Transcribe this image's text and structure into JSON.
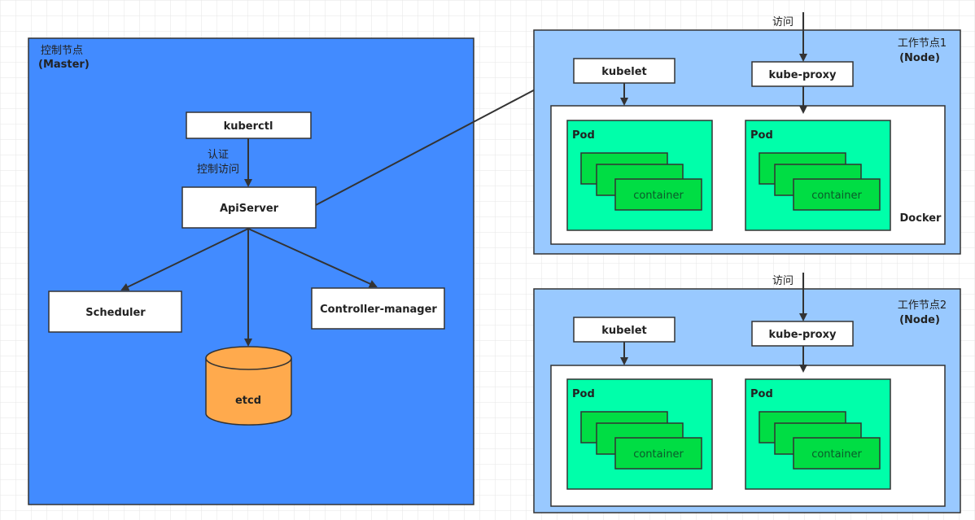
{
  "colors": {
    "master": "#428BFF",
    "node": "#99C9FF",
    "pod": "#00FFAA",
    "container": "#00DD44",
    "etcd": "#FFAA4D"
  },
  "master": {
    "title": "控制节点",
    "subtitle": "(Master)",
    "kuberctl": "kuberctl",
    "auth_line1": "认证",
    "auth_line2": "控制访问",
    "apiserver": "ApiServer",
    "scheduler": "Scheduler",
    "controller": "Controller-manager",
    "etcd": "etcd"
  },
  "nodes": [
    {
      "title": "工作节点1",
      "subtitle": "(Node)",
      "access": "访问",
      "kubelet": "kubelet",
      "kubeproxy": "kube-proxy",
      "runtime": "Docker",
      "pods": [
        {
          "label": "Pod",
          "container": "container"
        },
        {
          "label": "Pod",
          "container": "container"
        }
      ]
    },
    {
      "title": "工作节点2",
      "subtitle": "(Node)",
      "access": "访问",
      "kubelet": "kubelet",
      "kubeproxy": "kube-proxy",
      "runtime": "",
      "pods": [
        {
          "label": "Pod",
          "container": "container"
        },
        {
          "label": "Pod",
          "container": "container"
        }
      ]
    }
  ]
}
